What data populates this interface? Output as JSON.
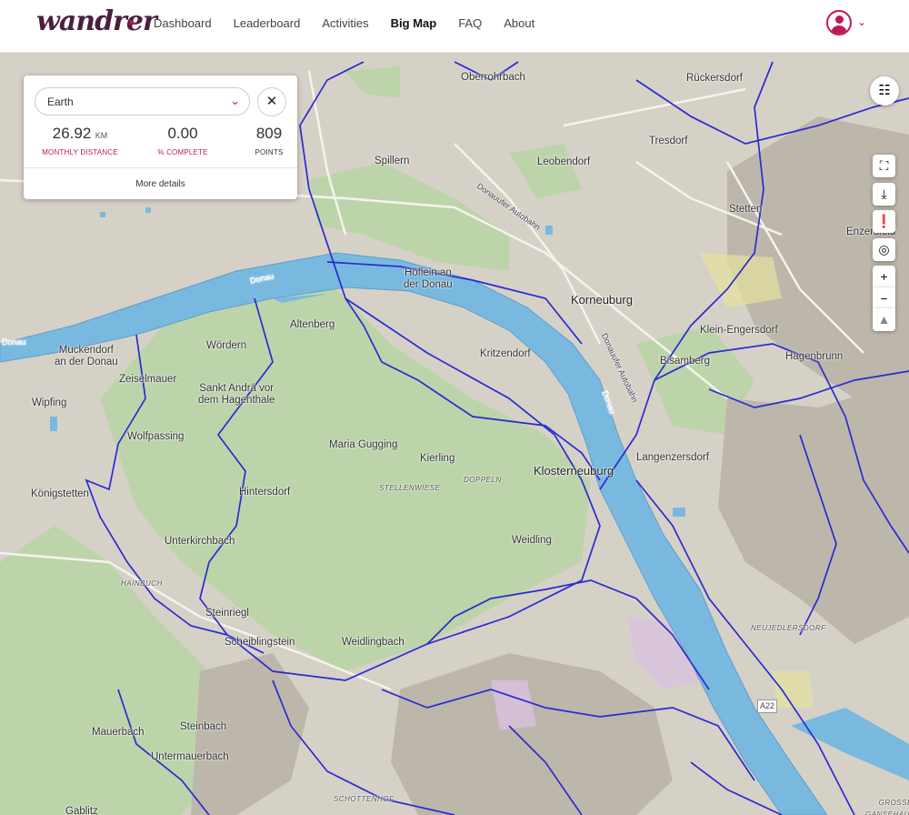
{
  "header": {
    "logo": "wandrer",
    "nav": [
      "Dashboard",
      "Leaderboard",
      "Activities",
      "Big Map",
      "FAQ",
      "About"
    ],
    "active_nav": "Big Map"
  },
  "stats_panel": {
    "region_select": "Earth",
    "close_label": "✕",
    "monthly_distance": {
      "value": "26.92",
      "unit": "KM",
      "label": "MONTHLY DISTANCE"
    },
    "percent_complete": {
      "value": "0.00",
      "label": "% COMPLETE"
    },
    "points": {
      "value": "809",
      "label": "POINTS"
    },
    "more_details": "More details"
  },
  "map_controls": [
    "filter-icon",
    "fullscreen-icon",
    "download-icon",
    "alert-icon",
    "locate-icon",
    "zoom-in-icon",
    "zoom-out-icon",
    "north-arrow-icon"
  ],
  "map_labels": {
    "oberrohrbach": "Oberrohrbach",
    "ruckersdorf": "Rückersdorf",
    "tresdorf": "Tresdorf",
    "spillern": "Spillern",
    "leobendorf": "Leobendorf",
    "stetten": "Stetten",
    "enzersfeld": "Enzersfeld",
    "hoflein": "Höflein an\nder Donau",
    "korneuburg": "Korneuburg",
    "altenberg": "Altenberg",
    "klein_engersdorf": "Klein-Engersdorf",
    "woerdern": "Wördern",
    "muckendorf": "Muckendorf\nan der Donau",
    "zeiselmauer": "Zeiselmauer",
    "kritzendorf": "Kritzendorf",
    "bisamberg": "Bisamberg",
    "hagenbrunn": "Hagenbrunn",
    "sankt_andra": "Sankt Andrä vor\ndem Hagenthale",
    "wipfing": "Wipfing",
    "maria_gugging": "Maria Gugging",
    "wolfpassing": "Wolfpassing",
    "kierling": "Kierling",
    "langenzersdorf": "Langenzersdorf",
    "klosterneuburg": "Klosterneuburg",
    "doppeln": "DOPPELN",
    "stellenwiese": "STELLENWIESE",
    "koenigstetten": "Königstetten",
    "hintersdorf": "Hintersdorf",
    "unterkirchbach": "Unterkirchbach",
    "weidling": "Weidling",
    "hainbuch": "HAINBUCH",
    "neujedlersdorf": "NEUJEDLERSDORF",
    "steinriegl": "Steinriegl",
    "scheiblingstein": "Scheiblingstein",
    "weidlingbach": "Weidlingbach",
    "steinbach": "Steinbach",
    "mauerbach": "Mauerbach",
    "untermauerbach": "Untermauerbach",
    "schottenhof": "SCHOTTENHOF",
    "gablitz": "Gablitz",
    "grosse_ganserhaufen": "GROSSE\nGANSEHAUFEN",
    "donau1": "Donau",
    "donau2": "Donau",
    "donau3": "Donau",
    "ufer_autobahn1": "Donauufer Autobahn",
    "ufer_autobahn2": "Donauufer Autobahn",
    "a22": "A22"
  },
  "colors": {
    "brand": "#c2185b",
    "river": "#6aaed6",
    "route": "#2b2bd0",
    "forest": "#b6d3a3",
    "land": "#d6d1c7"
  }
}
